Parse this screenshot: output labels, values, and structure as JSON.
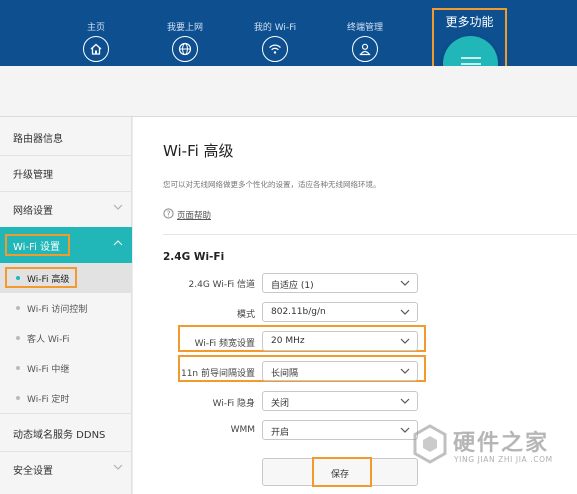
{
  "nav": {
    "items": [
      {
        "label": "主页",
        "icon": "home-icon"
      },
      {
        "label": "我要上网",
        "icon": "globe-icon"
      },
      {
        "label": "我的 Wi-Fi",
        "icon": "wifi-icon"
      },
      {
        "label": "终端管理",
        "icon": "user-icon"
      }
    ],
    "more_label": "更多功能",
    "more_icon": "menu-icon"
  },
  "sidebar": {
    "items": [
      {
        "label": "路由器信息"
      },
      {
        "label": "升级管理"
      },
      {
        "label": "网络设置"
      },
      {
        "label": "Wi-Fi 设置"
      },
      {
        "label": "动态域名服务 DDNS"
      },
      {
        "label": "安全设置"
      }
    ],
    "sub_items": [
      {
        "label": "Wi-Fi 高级"
      },
      {
        "label": "Wi-Fi 访问控制"
      },
      {
        "label": "客人 Wi-Fi"
      },
      {
        "label": "Wi-Fi 中继"
      },
      {
        "label": "Wi-Fi 定时"
      }
    ]
  },
  "main": {
    "title": "Wi-Fi 高级",
    "description": "您可以对无线网络做更多个性化的设置，适应各种无线网络环境。",
    "help_link": "页面帮助",
    "section_title": "2.4G Wi-Fi",
    "fields": [
      {
        "label": "2.4G Wi-Fi 信道",
        "value": "自适应 (1)"
      },
      {
        "label": "模式",
        "value": "802.11b/g/n"
      },
      {
        "label": "Wi-Fi 频宽设置",
        "value": "20 MHz"
      },
      {
        "label": "11n 前导间隔设置",
        "value": "长间隔"
      },
      {
        "label": "Wi-Fi 隐身",
        "value": "关闭"
      },
      {
        "label": "WMM",
        "value": "开启"
      }
    ],
    "save_label": "保存"
  },
  "watermark": {
    "cn": "硬件之家",
    "en": "YING JIAN ZHI JIA .COM"
  },
  "colors": {
    "nav_bg": "#0d4f8f",
    "accent": "#21b6b7",
    "highlight": "#f29a2e"
  }
}
